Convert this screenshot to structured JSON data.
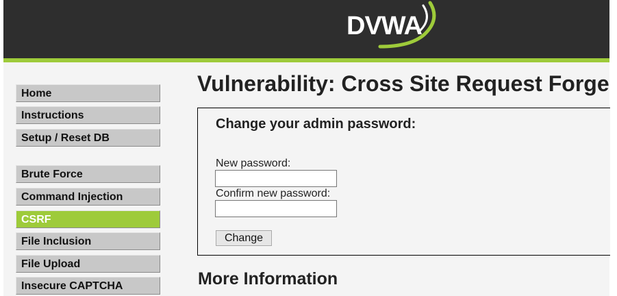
{
  "header": {
    "logo_text": "DVWA",
    "colors": {
      "bar": "#2e2e2e",
      "accent": "#9ecb3a"
    }
  },
  "menu": {
    "group1": [
      "Home",
      "Instructions",
      "Setup / Reset DB"
    ],
    "group2": [
      "Brute Force",
      "Command Injection",
      "CSRF",
      "File Inclusion",
      "File Upload",
      "Insecure CAPTCHA"
    ],
    "active": "CSRF"
  },
  "main": {
    "title": "Vulnerability: Cross Site Request Forgery (CSRF)",
    "form": {
      "heading": "Change your admin password:",
      "new_password_label": "New password:",
      "new_password_value": "",
      "confirm_password_label": "Confirm new password:",
      "confirm_password_value": "",
      "submit_label": "Change"
    },
    "more_info": "More Information"
  }
}
